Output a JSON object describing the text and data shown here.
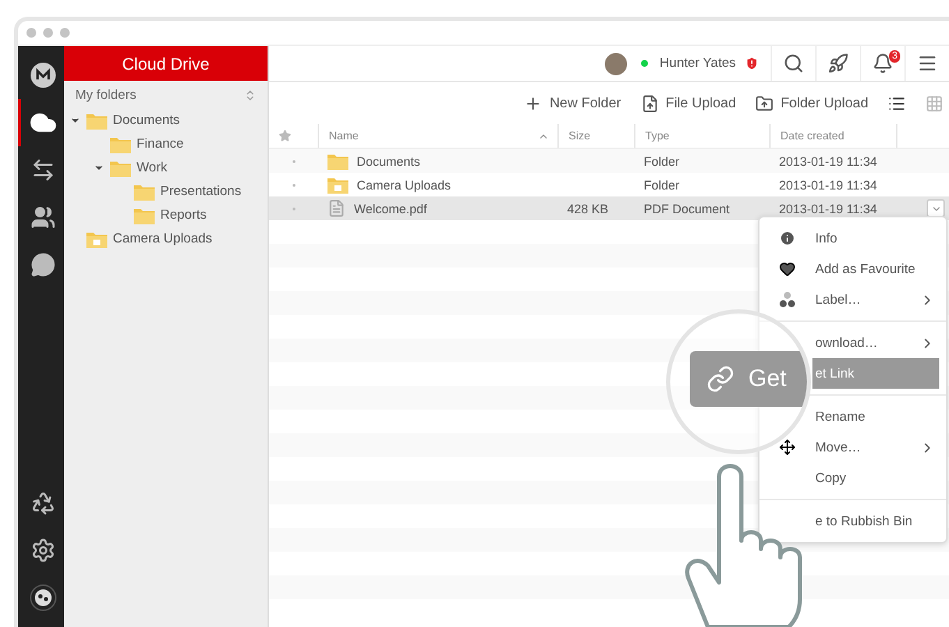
{
  "nav": [
    {
      "kind": "logo",
      "selected": false
    },
    {
      "kind": "cloud",
      "selected": true
    },
    {
      "kind": "transfers",
      "selected": false
    },
    {
      "kind": "contacts",
      "selected": false
    },
    {
      "kind": "chat",
      "selected": false
    },
    {
      "kind": "rubbish",
      "selected": false
    },
    {
      "kind": "settings",
      "selected": false
    },
    {
      "kind": "status",
      "selected": false
    }
  ],
  "sidebar": {
    "title": "Cloud Drive",
    "heading": "My folders",
    "tree": [
      {
        "label": "Documents",
        "kind": "folder",
        "expanded": true,
        "children": [
          {
            "label": "Finance",
            "kind": "folder"
          },
          {
            "label": "Work",
            "kind": "folder",
            "expanded": true,
            "children": [
              {
                "label": "Presentations",
                "kind": "folder"
              },
              {
                "label": "Reports",
                "kind": "folder"
              }
            ]
          }
        ]
      },
      {
        "label": "Camera Uploads",
        "kind": "camera"
      }
    ]
  },
  "topbar": {
    "user": "Hunter Yates",
    "online": true,
    "notifications": "3"
  },
  "toolbar": {
    "actions": [
      {
        "label": "New Folder",
        "kind": "new"
      },
      {
        "label": "File Upload",
        "kind": "file"
      },
      {
        "label": "Folder Upload",
        "kind": "folder"
      }
    ],
    "views": [
      {
        "kind": "list",
        "selected": true
      },
      {
        "kind": "grid",
        "selected": false
      }
    ]
  },
  "table": {
    "columns": [
      "Name",
      "Size",
      "Type",
      "Date created"
    ],
    "rows": [
      {
        "name": "Documents",
        "kind": "folder",
        "size": "",
        "type": "Folder",
        "date": "2013-01-19 11:34",
        "selected": false
      },
      {
        "name": "Camera Uploads",
        "kind": "camera",
        "size": "",
        "type": "Folder",
        "date": "2013-01-19 11:34",
        "selected": false
      },
      {
        "name": "Welcome.pdf",
        "kind": "pdf",
        "size": "428 KB",
        "type": "PDF Document",
        "date": "2013-01-19 11:34",
        "selected": true
      }
    ]
  },
  "context_menu": {
    "items": [
      {
        "kind": "info",
        "label": "Info",
        "submenu": false,
        "highlighted": false
      },
      {
        "kind": "heart",
        "label": "Add as Favourite",
        "submenu": false,
        "highlighted": false
      },
      {
        "kind": "label",
        "label": "Label…",
        "submenu": true,
        "highlighted": false
      },
      {
        "kind": "divider"
      },
      {
        "kind": "download",
        "label": "ownload…",
        "submenu": true,
        "highlighted": false
      },
      {
        "kind": "link",
        "label": "et Link",
        "submenu": false,
        "highlighted": true
      },
      {
        "kind": "divider"
      },
      {
        "kind": "rename",
        "label": "Rename",
        "submenu": false,
        "highlighted": false
      },
      {
        "kind": "move",
        "label": "Move…",
        "submenu": true,
        "highlighted": false
      },
      {
        "kind": "copy",
        "label": "Copy",
        "submenu": false,
        "highlighted": false
      },
      {
        "kind": "divider"
      },
      {
        "kind": "rubbish",
        "label": "e to Rubbish Bin",
        "submenu": false,
        "highlighted": false
      }
    ]
  },
  "magnifier": {
    "label": "Get"
  }
}
